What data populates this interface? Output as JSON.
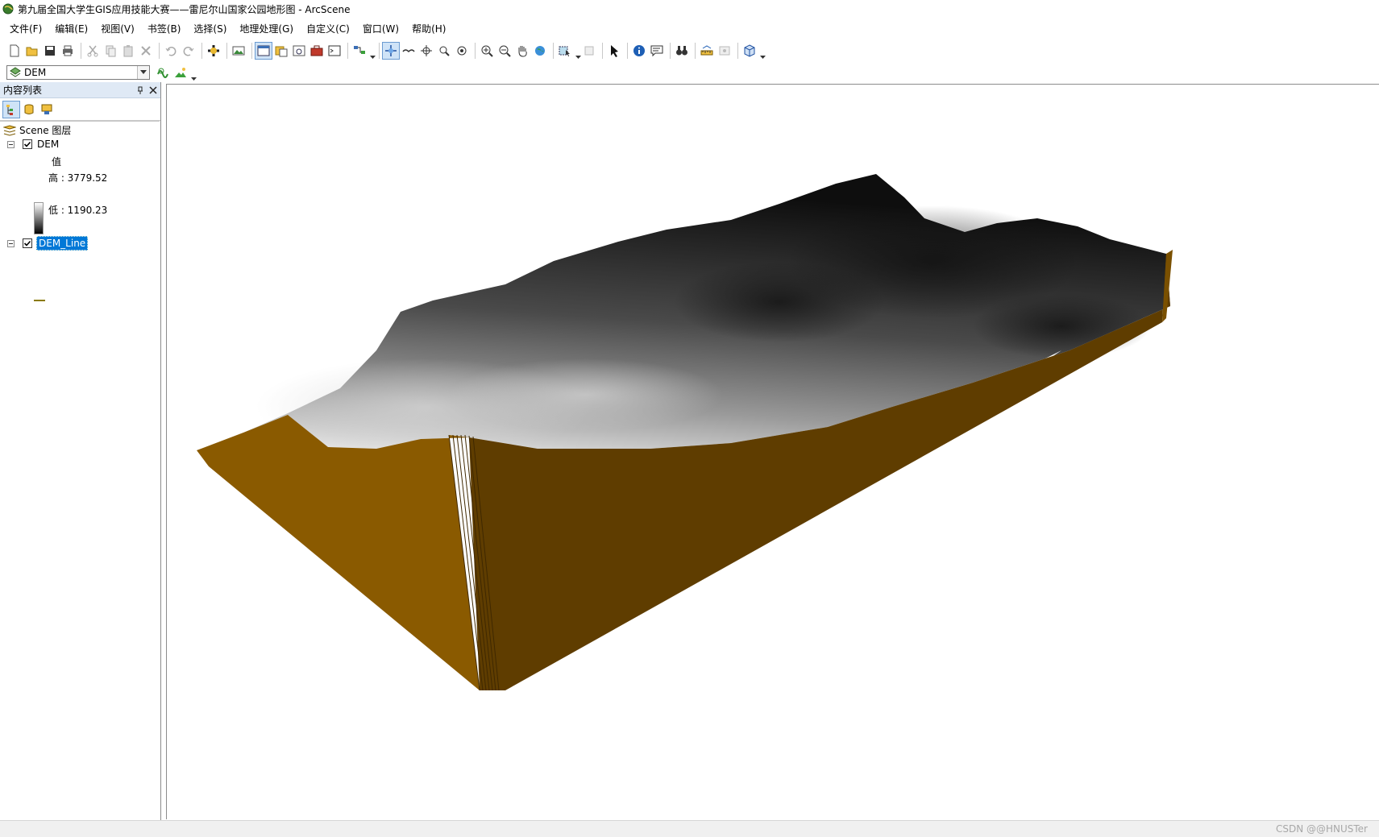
{
  "window": {
    "title": "第九届全国大学生GIS应用技能大赛——雷尼尔山国家公园地形图 - ArcScene"
  },
  "menu": {
    "items": [
      "文件(F)",
      "编辑(E)",
      "视图(V)",
      "书签(B)",
      "选择(S)",
      "地理处理(G)",
      "自定义(C)",
      "窗口(W)",
      "帮助(H)"
    ]
  },
  "layer_selector": {
    "value": "DEM"
  },
  "toc": {
    "title": "内容列表",
    "scene_label": "Scene 图层",
    "layers": [
      {
        "name": "DEM",
        "checked": true,
        "legend_heading": "值",
        "high_label": "高 : 3779.52",
        "low_label": "低 : 1190.23"
      },
      {
        "name": "DEM_Line",
        "checked": true,
        "selected": true
      }
    ]
  },
  "colors": {
    "terrain_wall_light": "#8a5a00",
    "terrain_wall_dark": "#5f3d00",
    "selection": "#0078d7"
  },
  "watermark": "CSDN @@HNUSTer"
}
